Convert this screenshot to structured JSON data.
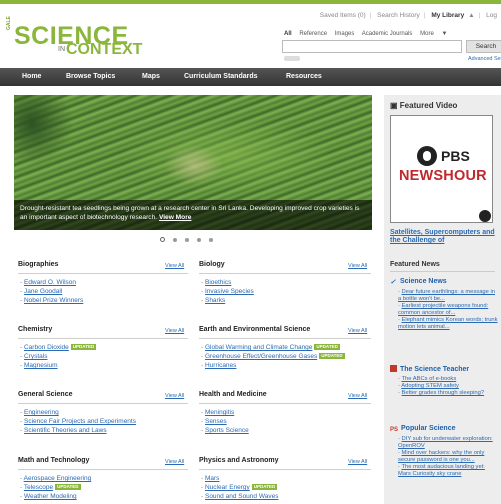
{
  "brand": {
    "gale": "GALE",
    "science": "SCIENCE",
    "in": "IN",
    "context": "CONTEXT"
  },
  "util_links": [
    "Saved Items (0)",
    "Search History",
    "My Library",
    "Log"
  ],
  "search": {
    "tabs": [
      "All",
      "Reference",
      "Images",
      "Academic Journals",
      "More"
    ],
    "placeholder": "",
    "button": "Search",
    "advanced": "Advanced Se"
  },
  "nav": [
    "Home",
    "Browse Topics",
    "Maps",
    "Curriculum Standards",
    "Resources"
  ],
  "hero": {
    "caption": "Drought-resistant tea seedlings being grown at a research center in Sri Lanka. Developing improved crop varieties is an important aspect of biotechnology research.",
    "more": "View More",
    "dots": 5,
    "active_dot": 0
  },
  "view_all": "View All",
  "updated": "UPDATED",
  "topics_left": [
    {
      "title": "Biographies",
      "items": [
        {
          "t": "Edward O. Wilson"
        },
        {
          "t": "Jane Goodall"
        },
        {
          "t": "Nobel Prize Winners"
        }
      ]
    },
    {
      "title": "Chemistry",
      "items": [
        {
          "t": "Carbon Dioxide",
          "badge": true
        },
        {
          "t": "Crystals"
        },
        {
          "t": "Magnesium"
        }
      ]
    },
    {
      "title": "General Science",
      "items": [
        {
          "t": "Engineering"
        },
        {
          "t": "Science Fair Projects and Experiments"
        },
        {
          "t": "Scientific Theories and Laws"
        }
      ]
    },
    {
      "title": "Math and Technology",
      "items": [
        {
          "t": "Aerospace Engineering"
        },
        {
          "t": "Telescope",
          "badge": true
        },
        {
          "t": "Weather Modeling"
        }
      ]
    }
  ],
  "topics_right": [
    {
      "title": "Biology",
      "items": [
        {
          "t": "Bioethics"
        },
        {
          "t": "Invasive Species"
        },
        {
          "t": "Sharks"
        }
      ]
    },
    {
      "title": "Earth and Environmental Science",
      "items": [
        {
          "t": "Global Warming and Climate Change",
          "badge": true
        },
        {
          "t": "Greenhouse Effect/Greenhouse Gases",
          "badge": true
        },
        {
          "t": "Hurricanes"
        }
      ]
    },
    {
      "title": "Health and Medicine",
      "items": [
        {
          "t": "Meningitis"
        },
        {
          "t": "Senses"
        },
        {
          "t": "Sports Science"
        }
      ]
    },
    {
      "title": "Physics and Astronomy",
      "items": [
        {
          "t": "Mars"
        },
        {
          "t": "Nuclear Energy",
          "badge": true
        },
        {
          "t": "Sound and Sound Waves"
        }
      ]
    }
  ],
  "sidebar": {
    "featured_video": "Featured Video",
    "video_pbs": "PBS",
    "video_newshour": "NEWSHOUR",
    "video_link": "Satellites, Supercomputers and the Challenge of",
    "featured_news": "Featured News",
    "sources": [
      {
        "name": "Science News",
        "color": "#1f5fa8",
        "items": [
          "Dear future earthlings: a message in a bottle won't be...",
          "Earliest projectile weapons found: common ancestor of...",
          "Elephant mimics Korean words; trunk motion lets animal..."
        ]
      },
      {
        "name": "The Science Teacher",
        "color": "#1f5fa8",
        "items": [
          "The ABCs of e-books",
          "Adopting STEM safety",
          "Better grades through sleeping?"
        ]
      },
      {
        "name": "Popular Science",
        "color": "#1f5fa8",
        "items": [
          "DIY sub for underwater exploration: OpenROV",
          "Mind over hackers: why the only secure password is one you...",
          "The most audacious landing yet: Mars Curiosity sky crane"
        ]
      }
    ]
  }
}
